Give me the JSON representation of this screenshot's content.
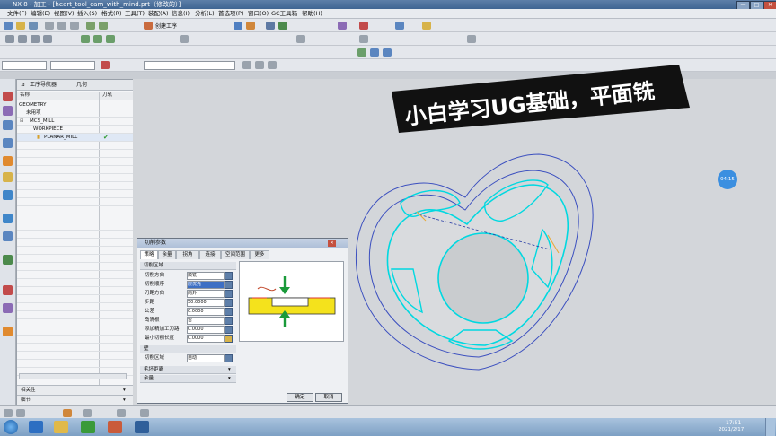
{
  "window": {
    "title": "NX 8 - 加工 - [heart_tool_cam_with_mind.prt（修改的）]",
    "minimize": "—",
    "maximize": "□",
    "close": "✕"
  },
  "menu": [
    "文件(F)",
    "编辑(E)",
    "视图(V)",
    "插入(S)",
    "格式(R)",
    "工具(T)",
    "装配(A)",
    "信息(I)",
    "分析(L)",
    "首选项(P)",
    "窗口(O)",
    "GC工具箱",
    "帮助(H)"
  ],
  "toolbar": {
    "create_operation_label": "创建工序"
  },
  "navigator": {
    "header_title": "工序导航器",
    "header_sub": "几何",
    "col_name": "名称",
    "col_path": "刀轨",
    "rows": [
      {
        "name": "GEOMETRY",
        "status": ""
      },
      {
        "name": "未用项",
        "status": ""
      },
      {
        "name": "MCS_MILL",
        "status": ""
      },
      {
        "name": "WORKPIECE",
        "status": ""
      },
      {
        "name": "PLANAR_MILL",
        "status": "✔"
      }
    ],
    "footer_items": [
      "相关性",
      "细节"
    ]
  },
  "banner": {
    "text": "小白学习UG基础，平面铣"
  },
  "overlay_badge": "04:15",
  "dialog": {
    "title": "切削参数",
    "close": "✕",
    "tabs": [
      "策略",
      "余量",
      "拐角",
      "连接",
      "空间范围",
      "更多"
    ],
    "section_cut": "切削区域",
    "fields": [
      {
        "label": "切削方向",
        "value": "顺铣"
      },
      {
        "label": "切削顺序",
        "value": "层优先"
      },
      {
        "label": "刀路方向",
        "value": "向外"
      },
      {
        "label": "步距",
        "value": "50.0000"
      },
      {
        "label": "公差",
        "value": "0.0000"
      },
      {
        "label": "岛清根",
        "value": "否"
      },
      {
        "label": "添加精加工刀路",
        "value": "0.0000"
      },
      {
        "label": "最小切削长度",
        "value": "0.0000"
      }
    ],
    "section_wall": "壁",
    "wall_field": {
      "label": "切削区域",
      "value": "自动"
    },
    "collapsed_sections": [
      "毛坯距离",
      "余量"
    ],
    "ok": "确定",
    "cancel": "取消"
  },
  "taskbar": {
    "clock_time": "17:51",
    "clock_date": "2021/2/17"
  }
}
